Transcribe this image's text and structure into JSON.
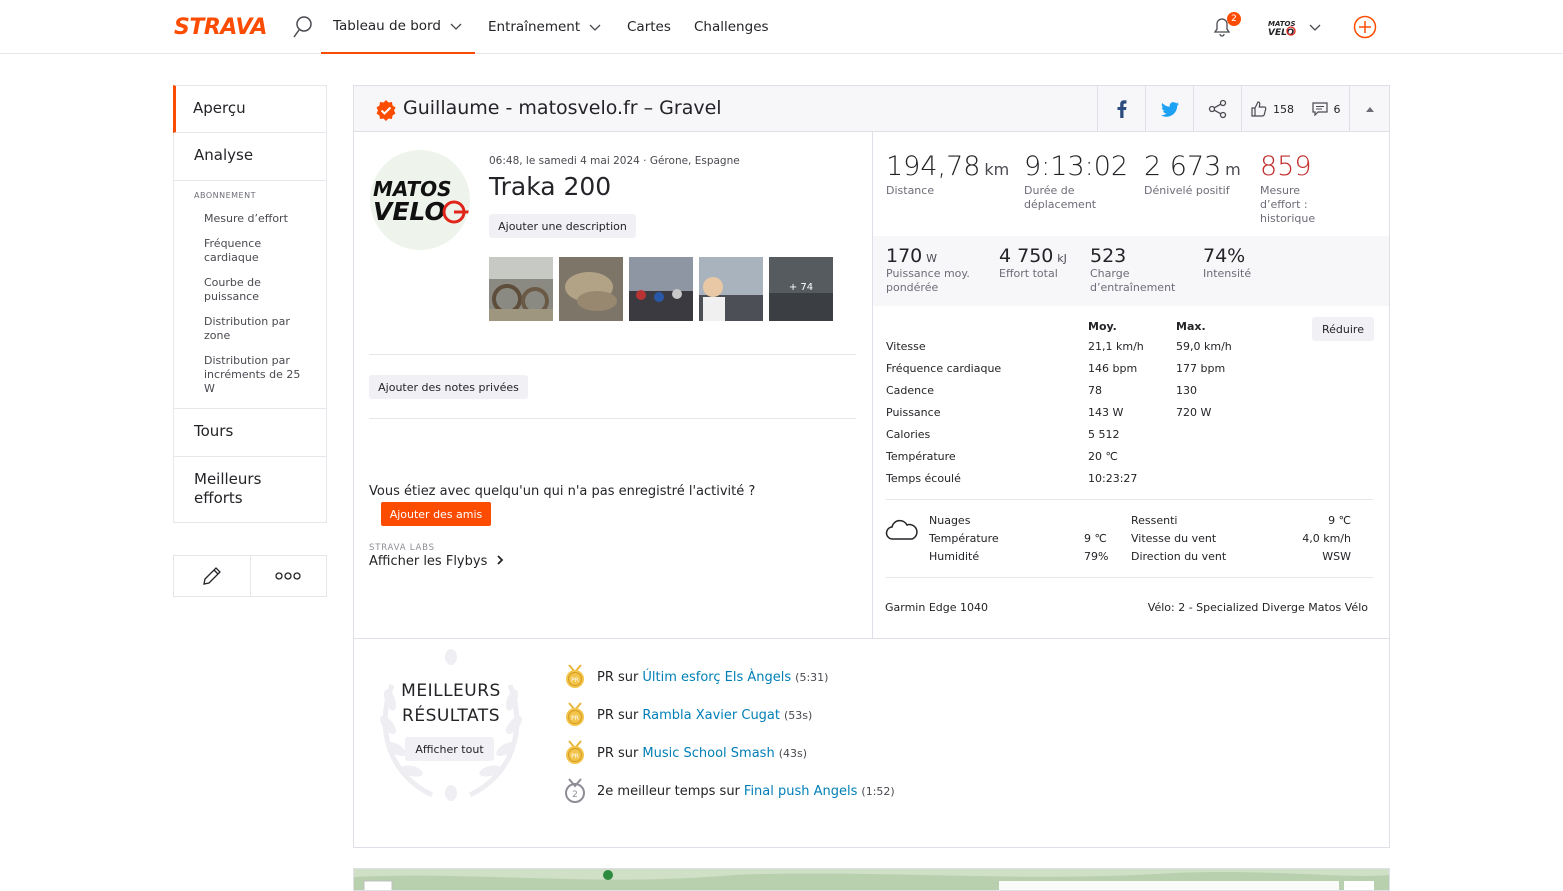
{
  "nav": {
    "logo": "STRAVA",
    "items": [
      {
        "label": "Tableau de bord",
        "has_menu": true,
        "active": true
      },
      {
        "label": "Entraînement",
        "has_menu": true
      },
      {
        "label": "Cartes"
      },
      {
        "label": "Challenges"
      }
    ],
    "notifications_count": "2",
    "avatar_text": "MATOS VELO"
  },
  "sidebar": {
    "overview": "Aperçu",
    "analysis": "Analyse",
    "subscription_heading": "ABONNEMENT",
    "sub_items": [
      "Mesure d’effort",
      "Fréquence cardiaque",
      "Courbe de puissance",
      "Distribution par zone",
      "Distribution par incréments de 25 W"
    ],
    "laps": "Tours",
    "best_efforts": "Meilleurs efforts"
  },
  "activity": {
    "athlete_heading": "Guillaume - matosvelo.fr – Gravel",
    "kudos": "158",
    "comments": "6",
    "meta": "06:48, le samedi 4 mai 2024 · Gérone, Espagne",
    "title": "Traka 200",
    "add_description": "Ajouter une description",
    "photo_more": "+ 74",
    "add_notes": "Ajouter des notes privées",
    "friends_question": "Vous étiez avec quelqu'un qui n'a pas enregistré l'activité ?",
    "add_friends": "Ajouter des amis",
    "labs_tag": "STRAVA LABS",
    "flybys": "Afficher les Flybys"
  },
  "stats": {
    "distance": {
      "value": "194,78",
      "unit": "km",
      "label": "Distance"
    },
    "moving_time": {
      "value": "9:13:02",
      "label": "Durée de déplacement"
    },
    "elevation": {
      "value": "2 673",
      "unit": "m",
      "label": "Dénivelé positif"
    },
    "effort": {
      "value": "859",
      "label": "Mesure d’effort : historique"
    },
    "power": {
      "value": "170",
      "unit": "W",
      "label": "Puissance moy. pondérée"
    },
    "work": {
      "value": "4 750",
      "unit": "kJ",
      "label": "Effort total"
    },
    "load": {
      "value": "523",
      "label": "Charge d’entraînement"
    },
    "intensity": {
      "value": "74%",
      "label": "Intensité"
    }
  },
  "metrics": {
    "col_avg": "Moy.",
    "col_max": "Max.",
    "reduce": "Réduire",
    "rows": [
      {
        "label": "Vitesse",
        "avg": "21,1 km/h",
        "max": "59,0 km/h"
      },
      {
        "label": "Fréquence cardiaque",
        "avg": "146 bpm",
        "max": "177 bpm"
      },
      {
        "label": "Cadence",
        "avg": "78",
        "max": "130"
      },
      {
        "label": "Puissance",
        "avg": "143 W",
        "max": "720 W"
      },
      {
        "label": "Calories",
        "avg": "5 512",
        "max": ""
      },
      {
        "label": "Température",
        "avg": "20  ℃",
        "max": ""
      },
      {
        "label": "Temps écoulé",
        "avg": "10:23:27",
        "max": ""
      }
    ]
  },
  "weather": {
    "condition": "Nuages",
    "temperature_label": "Température",
    "temperature": "9  ℃",
    "humidity_label": "Humidité",
    "humidity": "79%",
    "feels_like_label": "Ressenti",
    "feels_like": "9  ℃",
    "wind_speed_label": "Vitesse du vent",
    "wind_speed": "4,0 km/h",
    "wind_dir_label": "Direction du vent",
    "wind_dir": "WSW"
  },
  "device": "Garmin Edge 1040",
  "bike": "Vélo: 2 - Specialized Diverge Matos Vélo",
  "best": {
    "title_line1": "MEILLEURS",
    "title_line2": "RÉSULTATS",
    "view_all": "Afficher tout",
    "items": [
      {
        "prefix": "PR",
        "mid": "sur",
        "segment": "Últim esforç Els Àngels",
        "time": "(5:31)",
        "medal": "gold"
      },
      {
        "prefix": "PR",
        "mid": "sur",
        "segment": "Rambla Xavier Cugat",
        "time": "(53s)",
        "medal": "gold"
      },
      {
        "prefix": "PR",
        "mid": "sur",
        "segment": "Music School Smash",
        "time": "(43s)",
        "medal": "gold"
      },
      {
        "prefix": "2e meilleur temps",
        "mid": "sur",
        "segment": "Final push Angels",
        "time": "(1:52)",
        "medal": "silver"
      }
    ]
  },
  "colors": {
    "accent": "#fc4c02",
    "effort_red": "#c32c2c",
    "link": "#007fb6"
  }
}
